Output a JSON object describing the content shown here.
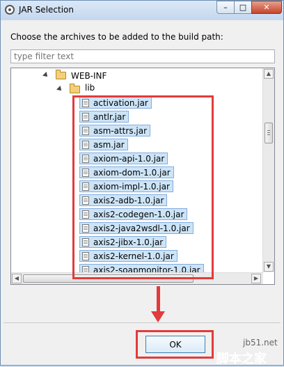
{
  "window": {
    "title": "JAR Selection",
    "controls": {
      "minimize": "–",
      "maximize": "□",
      "close": "✕"
    }
  },
  "prompt": "Choose the archives to be added to the build path:",
  "filter": {
    "placeholder": "type filter text",
    "value": ""
  },
  "tree": {
    "nodes": [
      {
        "label": "WEB-INF",
        "icon": "folder-open-icon"
      },
      {
        "label": "lib",
        "icon": "folder-open-icon"
      }
    ],
    "jars": [
      "activation.jar",
      "antlr.jar",
      "asm-attrs.jar",
      "asm.jar",
      "axiom-api-1.0.jar",
      "axiom-dom-1.0.jar",
      "axiom-impl-1.0.jar",
      "axis2-adb-1.0.jar",
      "axis2-codegen-1.0.jar",
      "axis2-java2wsdl-1.0.jar",
      "axis2-jibx-1.0.jar",
      "axis2-kernel-1.0.jar",
      "axis2-soapmonitor-1.0.jar"
    ]
  },
  "buttons": {
    "ok": "OK"
  },
  "watermark": {
    "site": "jb51.net",
    "cn": "脚本之家"
  },
  "colors": {
    "annotation": "#e23b3b",
    "selection": "#cce4f7"
  }
}
